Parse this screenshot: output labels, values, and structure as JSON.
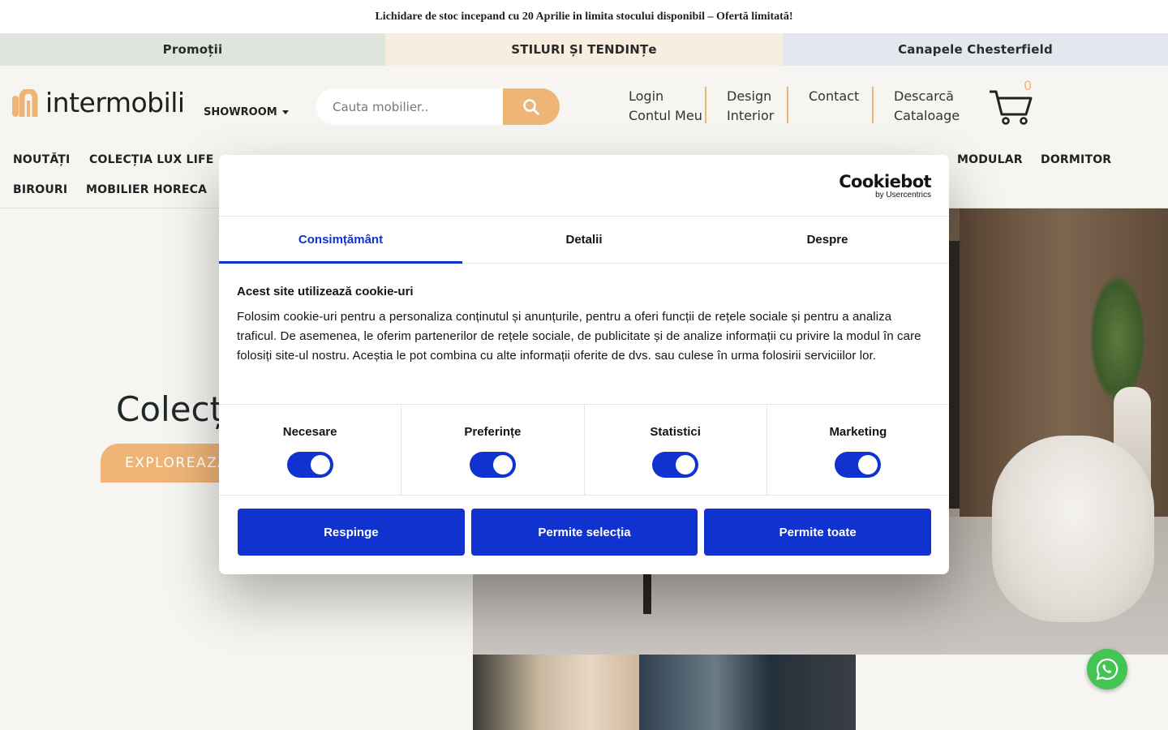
{
  "announcement": "Lichidare de stoc incepand cu 20 Aprilie in limita stocului disponibil – Ofertă limitată!",
  "promo_bar": [
    "Promoții",
    "STILURI ȘI TENDINȚe",
    "Canapele Chesterfield"
  ],
  "brand": {
    "name": "intermobili",
    "accent": "#efb577"
  },
  "showroom": "SHOWROOM",
  "search": {
    "placeholder": "Cauta mobilier.."
  },
  "header_links": {
    "login": [
      "Login",
      "Contul Meu"
    ],
    "design": [
      "Design",
      "Interior"
    ],
    "contact": [
      "Contact"
    ],
    "catalog": [
      "Descarcă",
      "Cataloage"
    ]
  },
  "cart_count": "0",
  "nav": {
    "row1": [
      "NOUTĂȚI",
      "COLECȚIA LUX LIFE"
    ],
    "row1_right": [
      "MODULAR",
      "DORMITOR"
    ],
    "row2": [
      "BIROURI",
      "MOBILIER HORECA"
    ]
  },
  "hero": {
    "title": "Colecți",
    "button": "EXPLOREAZĂ"
  },
  "cookie": {
    "logo_big": "Cookiebot",
    "logo_small": "by Usercentrics",
    "tabs": [
      "Consimțământ",
      "Detalii",
      "Despre"
    ],
    "heading": "Acest site utilizează cookie-uri",
    "body": "Folosim cookie-uri pentru a personaliza conținutul și anunțurile, pentru a oferi funcții de rețele sociale și pentru a analiza traficul. De asemenea, le oferim partenerilor de rețele sociale, de publicitate și de analize informații cu privire la modul în care folosiți site-ul nostru. Aceștia le pot combina cu alte informații oferite de dvs. sau culese în urma folosirii serviciilor lor.",
    "toggles": [
      "Necesare",
      "Preferințe",
      "Statistici",
      "Marketing"
    ],
    "buttons": [
      "Respinge",
      "Permite selecția",
      "Permite toate"
    ],
    "accent": "#1032cf"
  }
}
